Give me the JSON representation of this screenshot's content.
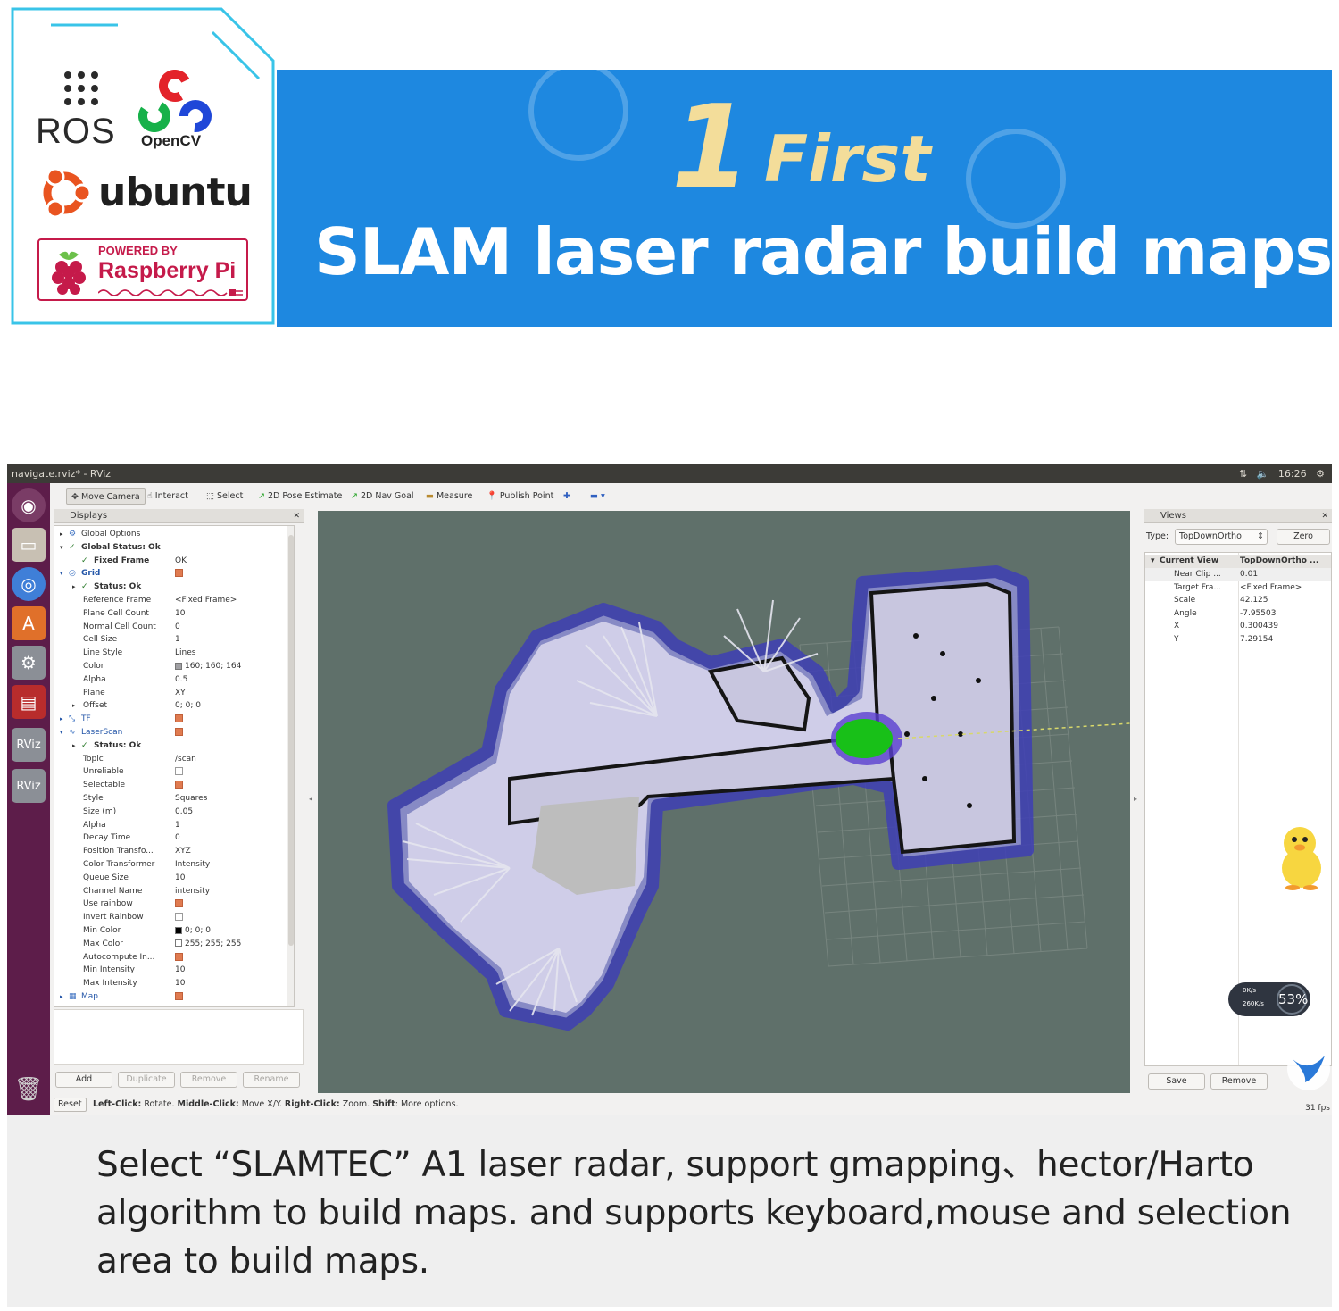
{
  "banner": {
    "number": "1",
    "first_label": "First",
    "headline": "SLAM laser radar build maps"
  },
  "logos": {
    "ros": "ROS",
    "opencv": "OpenCV",
    "ubuntu": "ubuntu",
    "rpi_powered": "POWERED BY",
    "rpi_name": "Raspberry Pi"
  },
  "rviz": {
    "window_title": "navigate.rviz* - RViz",
    "clock": "16:26",
    "toolbar": [
      {
        "label": "Move Camera",
        "icon": "move-camera-icon",
        "active": true
      },
      {
        "label": "Interact",
        "icon": "interact-icon"
      },
      {
        "label": "Select",
        "icon": "select-icon"
      },
      {
        "label": "2D Pose Estimate",
        "icon": "pose-estimate-icon"
      },
      {
        "label": "2D Nav Goal",
        "icon": "nav-goal-icon"
      },
      {
        "label": "Measure",
        "icon": "measure-icon"
      },
      {
        "label": "Publish Point",
        "icon": "publish-point-icon"
      }
    ],
    "displays": {
      "title": "Displays",
      "rows": [
        {
          "key": "Global Options",
          "indent": 1,
          "arrow": "▸",
          "icon": "⚙",
          "value": ""
        },
        {
          "key": "Global Status: Ok",
          "indent": 1,
          "arrow": "▾",
          "icon": "✓",
          "value": "",
          "bold": true
        },
        {
          "key": "Fixed Frame",
          "indent": 2,
          "icon": "✓",
          "value": "OK",
          "bold": true
        },
        {
          "key": "Grid",
          "indent": 1,
          "arrow": "▾",
          "icon": "◎",
          "value": "",
          "blue": true,
          "bold": true,
          "check": true
        },
        {
          "key": "Status: Ok",
          "indent": 2,
          "arrow": "▸",
          "icon": "✓",
          "value": "",
          "bold": true
        },
        {
          "key": "Reference Frame",
          "indent": 2,
          "value": "<Fixed Frame>"
        },
        {
          "key": "Plane Cell Count",
          "indent": 2,
          "value": "10"
        },
        {
          "key": "Normal Cell Count",
          "indent": 2,
          "value": "0"
        },
        {
          "key": "Cell Size",
          "indent": 2,
          "value": "1"
        },
        {
          "key": "Line Style",
          "indent": 2,
          "value": "Lines"
        },
        {
          "key": "Color",
          "indent": 2,
          "value": "160; 160; 164",
          "swatch": "#a0a0a4"
        },
        {
          "key": "Alpha",
          "indent": 2,
          "value": "0.5"
        },
        {
          "key": "Plane",
          "indent": 2,
          "value": "XY"
        },
        {
          "key": "Offset",
          "indent": 2,
          "arrow": "▸",
          "value": "0; 0; 0"
        },
        {
          "key": "TF",
          "indent": 1,
          "arrow": "▸",
          "icon": "⤡",
          "value": "",
          "blue": true,
          "check": true
        },
        {
          "key": "LaserScan",
          "indent": 1,
          "arrow": "▾",
          "icon": "∿",
          "value": "",
          "blue": true,
          "check": true
        },
        {
          "key": "Status: Ok",
          "indent": 2,
          "arrow": "▸",
          "icon": "✓",
          "value": "",
          "bold": true
        },
        {
          "key": "Topic",
          "indent": 2,
          "value": "/scan"
        },
        {
          "key": "Unreliable",
          "indent": 2,
          "value": "",
          "checkbox": false
        },
        {
          "key": "Selectable",
          "indent": 2,
          "value": "",
          "checkbox": true
        },
        {
          "key": "Style",
          "indent": 2,
          "value": "Squares"
        },
        {
          "key": "Size (m)",
          "indent": 2,
          "value": "0.05"
        },
        {
          "key": "Alpha",
          "indent": 2,
          "value": "1"
        },
        {
          "key": "Decay Time",
          "indent": 2,
          "value": "0"
        },
        {
          "key": "Position Transfo...",
          "indent": 2,
          "value": "XYZ"
        },
        {
          "key": "Color Transformer",
          "indent": 2,
          "value": "Intensity"
        },
        {
          "key": "Queue Size",
          "indent": 2,
          "value": "10"
        },
        {
          "key": "Channel Name",
          "indent": 2,
          "value": "intensity"
        },
        {
          "key": "Use rainbow",
          "indent": 2,
          "value": "",
          "checkbox": true
        },
        {
          "key": "Invert Rainbow",
          "indent": 2,
          "value": "",
          "checkbox": false
        },
        {
          "key": "Min Color",
          "indent": 2,
          "value": "0; 0; 0",
          "swatch": "#000000"
        },
        {
          "key": "Max Color",
          "indent": 2,
          "value": "255; 255; 255",
          "swatch": "#ffffff"
        },
        {
          "key": "Autocompute In...",
          "indent": 2,
          "value": "",
          "checkbox": true
        },
        {
          "key": "Min Intensity",
          "indent": 2,
          "value": "10"
        },
        {
          "key": "Max Intensity",
          "indent": 2,
          "value": "10"
        },
        {
          "key": "Map",
          "indent": 1,
          "arrow": "▸",
          "icon": "▦",
          "value": "",
          "blue": true,
          "check": true
        }
      ],
      "buttons": [
        {
          "label": "Add",
          "enabled": true
        },
        {
          "label": "Duplicate",
          "enabled": false
        },
        {
          "label": "Remove",
          "enabled": false
        },
        {
          "label": "Rename",
          "enabled": false
        }
      ]
    },
    "views": {
      "title": "Views",
      "type_label": "Type:",
      "type_value": "TopDownOrtho",
      "zero_label": "Zero",
      "header_key": "Current View",
      "header_value": "TopDownOrtho ...",
      "rows": [
        {
          "key": "Near Clip ...",
          "value": "0.01"
        },
        {
          "key": "Target Fra...",
          "value": "<Fixed Frame>"
        },
        {
          "key": "Scale",
          "value": "42.125"
        },
        {
          "key": "Angle",
          "value": "-7.95503"
        },
        {
          "key": "X",
          "value": "0.300439"
        },
        {
          "key": "Y",
          "value": "7.29154"
        }
      ],
      "buttons": [
        "Save",
        "Remove"
      ]
    },
    "status": {
      "reset": "Reset",
      "b1": "Left-Click:",
      "t1": " Rotate. ",
      "b2": "Middle-Click:",
      "t2": " Move X/Y. ",
      "b3": "Right-Click:",
      "t3": " Zoom. ",
      "b4": "Shift",
      "t4": ": More options.",
      "fps": "31 fps"
    },
    "speed_widget": {
      "up": "0K/s",
      "down": "260K/s",
      "percent": "53%"
    }
  },
  "caption": {
    "text": "Select “SLAMTEC” A1 laser radar, support gmapping、hector/Harto algorithm to build maps. and supports keyboard,mouse and selection area to build maps."
  },
  "colors": {
    "banner_blue": "#1e88e0",
    "gold": "#f3dd9a",
    "ubuntu_orange": "#e95420",
    "raspberry": "#c51a4a",
    "launcher_purple": "#5d1d4a",
    "view_bg": "#5f706a"
  }
}
